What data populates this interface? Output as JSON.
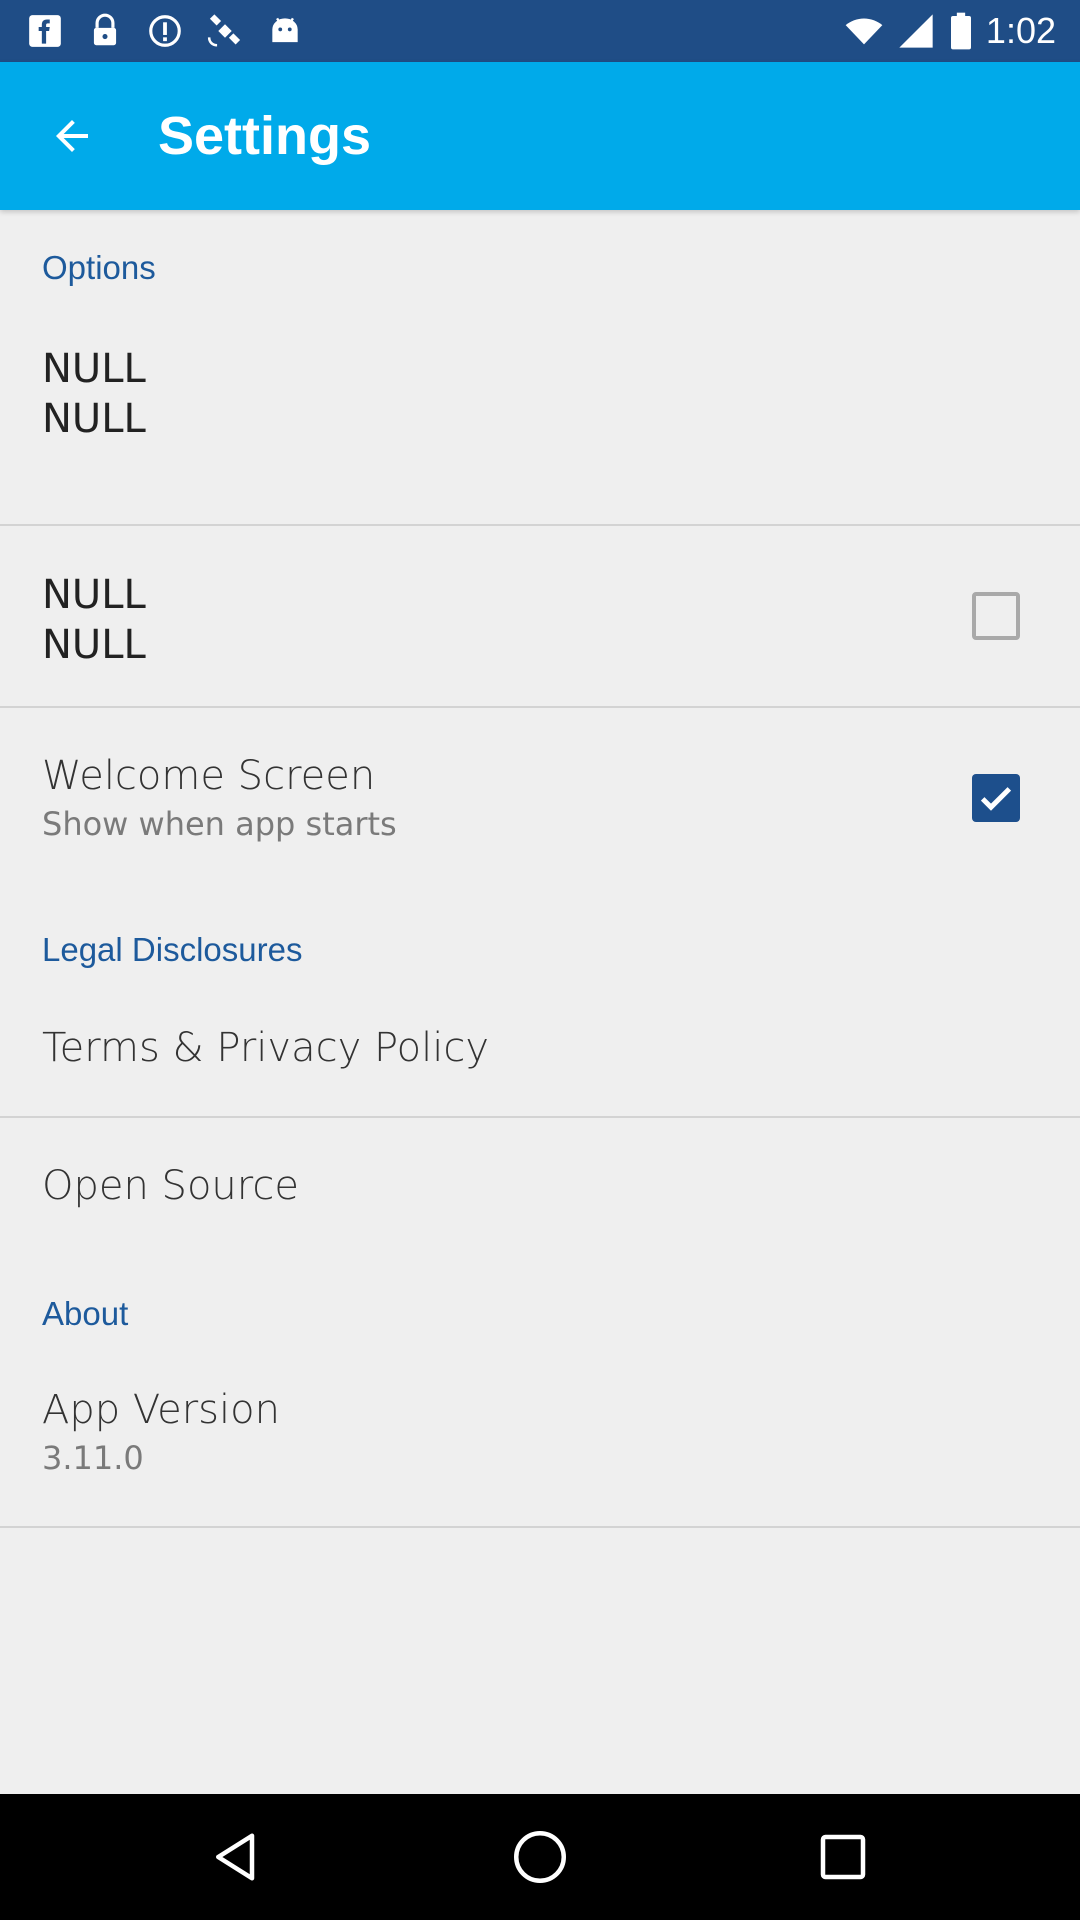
{
  "status_bar": {
    "time": "1:02",
    "left_icons": [
      "app-f-icon",
      "lock-icon",
      "data-saver-icon",
      "satellite-fake-gps-icon",
      "android-icon"
    ],
    "right_icons": [
      "wifi-icon",
      "signal-icon",
      "battery-icon"
    ]
  },
  "app_bar": {
    "title": "Settings",
    "color": "#00aaea"
  },
  "sections": {
    "options": {
      "header": "Options",
      "item1": {
        "line1": "NULL",
        "line2": "NULL"
      },
      "item2": {
        "line1": "NULL",
        "line2": "NULL",
        "checked": false
      },
      "welcome": {
        "title": "Welcome Screen",
        "summary": "Show when app starts",
        "checked": true
      }
    },
    "legal": {
      "header": "Legal Disclosures",
      "terms": "Terms & Privacy Policy",
      "open_source": "Open Source"
    },
    "about": {
      "header": "About",
      "version_title": "App Version",
      "version_value": "3.11.0"
    }
  },
  "colors": {
    "status_bar": "#1f4d86",
    "accent": "#1d5a9c",
    "checkbox_checked": "#1d4f8c",
    "background": "#efefef"
  },
  "nav_bar": {
    "buttons": [
      "back-triangle-icon",
      "home-circle-icon",
      "recents-square-icon"
    ]
  }
}
